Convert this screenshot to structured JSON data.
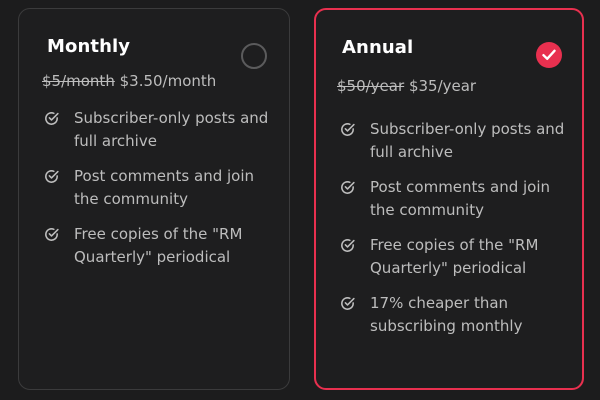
{
  "plans": {
    "monthly": {
      "title": "Monthly",
      "selected": false,
      "price_old": "$5/month",
      "price_new": "$3.50/month",
      "features": [
        "Subscriber-only posts and full archive",
        "Post comments and join the community",
        "Free copies of the \"RM Quarterly\" periodical"
      ]
    },
    "annual": {
      "title": "Annual",
      "selected": true,
      "price_old": "$50/year",
      "price_new": "$35/year",
      "features": [
        "Subscriber-only posts and full archive",
        "Post comments and join the community",
        "Free copies of the \"RM Quarterly\" periodical",
        "17% cheaper than subscribing monthly"
      ]
    }
  },
  "colors": {
    "background": "#1c1c1d",
    "accent": "#e8304f",
    "card_border": "#3b3b3c",
    "title": "#ffffff",
    "text": "#bdbdbd"
  },
  "icons": {
    "feature": "check-circle-icon",
    "selected": "checkmark-icon"
  }
}
